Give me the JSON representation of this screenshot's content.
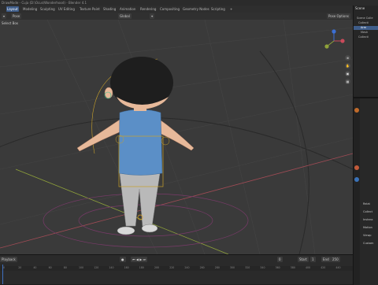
{
  "titlebar": {
    "title": "DrawMode - Cuja (D:\\Ocus\\Wonderhood) - Blender 4.1"
  },
  "workspaces": [
    "Layout",
    "Modeling",
    "Sculpting",
    "UV Editing",
    "Texture Paint",
    "Shading",
    "Animation",
    "Rendering",
    "Compositing",
    "Geometry Nodes",
    "Scripting"
  ],
  "header": {
    "mode": "Pose",
    "transform_orientation": "Global",
    "pose_options": "Pose Options",
    "select_box": "Select Box"
  },
  "outliner": {
    "title": "Scene",
    "items": [
      "Scene Colle",
      "Collecti",
      "Arm",
      "Mesh",
      "Collecti"
    ]
  },
  "properties": {
    "labels": [
      "Relat",
      "Collect",
      "Instanc",
      "Motion",
      "Viewp",
      "Custom",
      "Groups",
      "Custom"
    ]
  },
  "timeline": {
    "playback_label": "Playback",
    "current_frame": "0",
    "start_label": "Start",
    "start": "1",
    "end_label": "End",
    "end": "250",
    "ticks": [
      "0",
      "20",
      "40",
      "60",
      "80",
      "100",
      "120",
      "140",
      "160",
      "180",
      "200",
      "220",
      "240",
      "260",
      "280",
      "300",
      "320",
      "340",
      "360",
      "380",
      "400",
      "420",
      "440"
    ]
  },
  "colors": {
    "accent": "#3f5d8a",
    "x_axis": "#a04b55",
    "y_axis": "#8fa23a",
    "shirt": "#5b8fc7",
    "pants": "#b9b9b9",
    "hair": "#1e1e1e",
    "skin": "#e7b99a",
    "bone_box": "#c9a12a"
  },
  "icons": [
    "grid-icon",
    "camera-icon",
    "hand-icon",
    "zoom-icon",
    "play-icon",
    "record-icon"
  ]
}
